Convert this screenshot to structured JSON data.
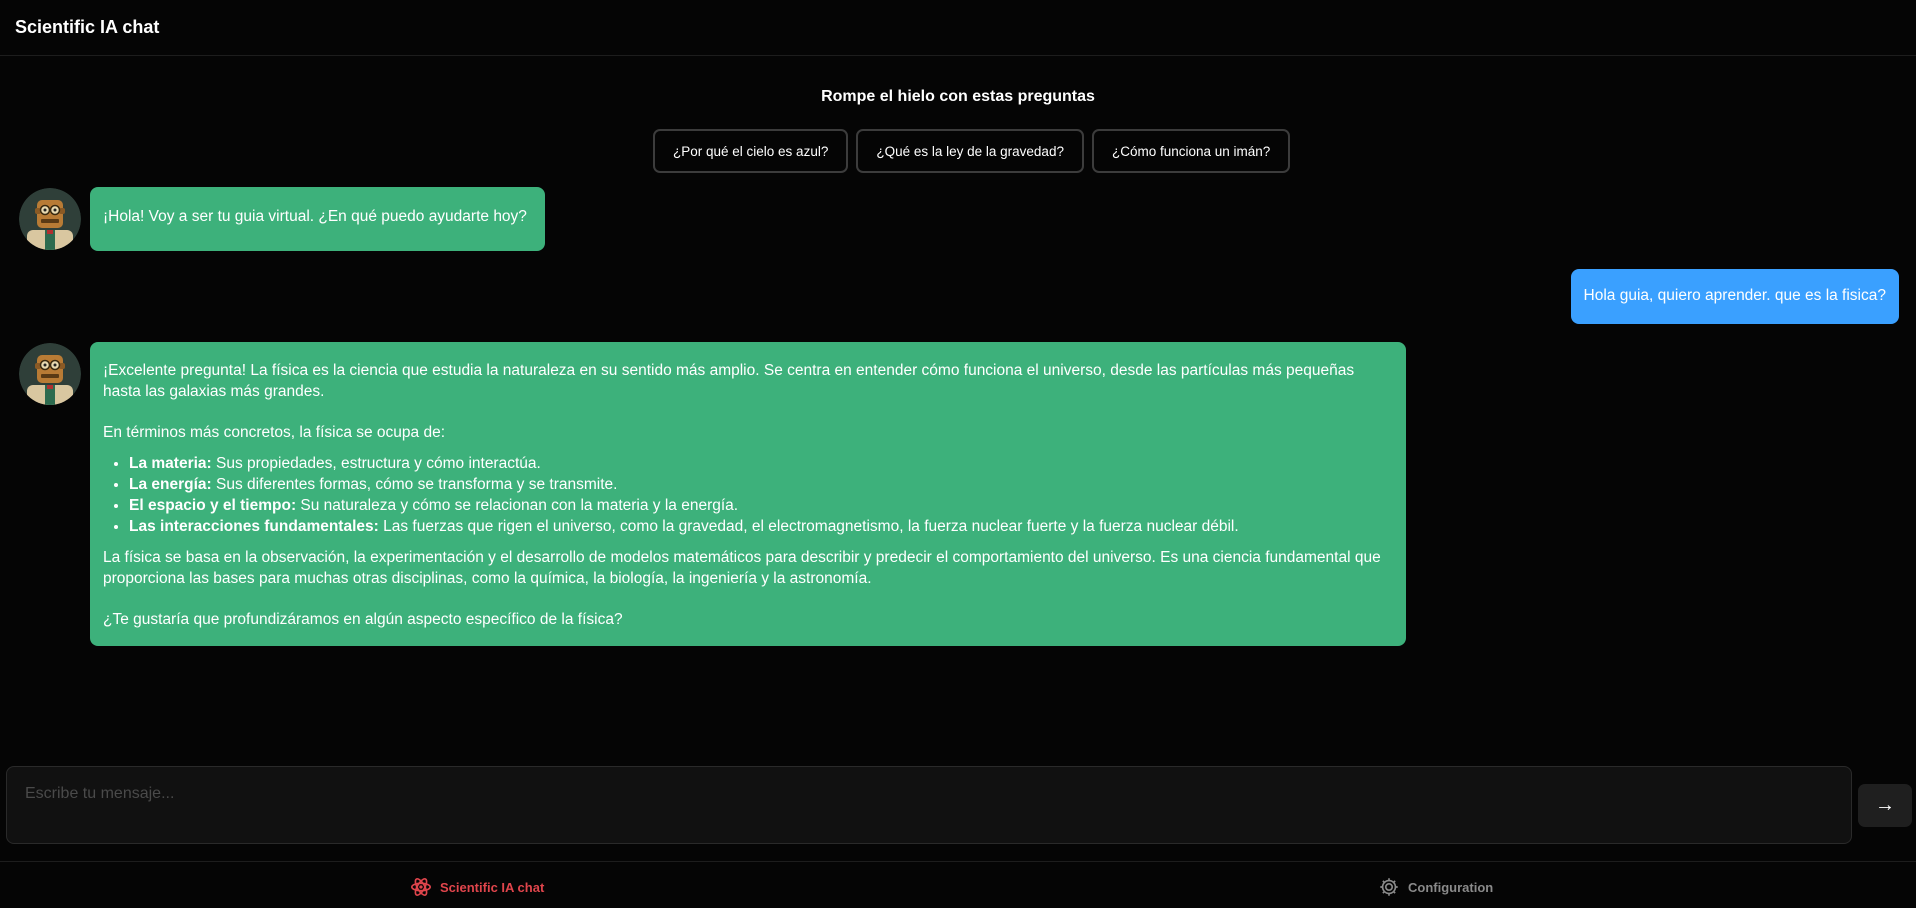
{
  "header": {
    "title": "Scientific IA chat"
  },
  "icebreakers": {
    "title": "Rompe el hielo con estas preguntas",
    "questions": [
      "¿Por qué el cielo es azul?",
      "¿Qué es la ley de la gravedad?",
      "¿Cómo funciona un imán?"
    ]
  },
  "messages": {
    "bot_greeting": "¡Hola! Voy a ser tu guia virtual. ¿En qué puedo ayudarte hoy?",
    "user_question": "Hola guia, quiero aprender. que es la fisica?",
    "bot_answer": {
      "intro": "¡Excelente pregunta! La física es la ciencia que estudia la naturaleza en su sentido más amplio. Se centra en entender cómo funciona el universo, desde las partículas más pequeñas hasta las galaxias más grandes.",
      "lead": "En términos más concretos, la física se ocupa de:",
      "items": [
        {
          "term": "La materia:",
          "text": " Sus propiedades, estructura y cómo interactúa."
        },
        {
          "term": "La energía:",
          "text": " Sus diferentes formas, cómo se transforma y se transmite."
        },
        {
          "term": "El espacio y el tiempo:",
          "text": " Su naturaleza y cómo se relacionan con la materia y la energía."
        },
        {
          "term": "Las interacciones fundamentales:",
          "text": " Las fuerzas que rigen el universo, como la gravedad, el electromagnetismo, la fuerza nuclear fuerte y la fuerza nuclear débil."
        }
      ],
      "body": "La física se basa en la observación, la experimentación y el desarrollo de modelos matemáticos para describir y predecir el comportamiento del universo. Es una ciencia fundamental que proporciona las bases para muchas otras disciplinas, como la química, la biología, la ingeniería y la astronomía.",
      "closing": "¿Te gustaría que profundizáramos en algún aspecto específico de la física?"
    }
  },
  "composer": {
    "placeholder": "Escribe tu mensaje...",
    "value": "",
    "send_label": "→"
  },
  "bottom_nav": {
    "chat_label": "Scientific IA chat",
    "config_label": "Configuration",
    "chat_icon": "atom-icon",
    "config_icon": "gear-icon"
  },
  "colors": {
    "background": "#050505",
    "bot_bubble": "#3db17b",
    "user_bubble": "#3aa0ff",
    "active_nav": "#e0454c",
    "inactive_nav": "#8a8a8a"
  }
}
